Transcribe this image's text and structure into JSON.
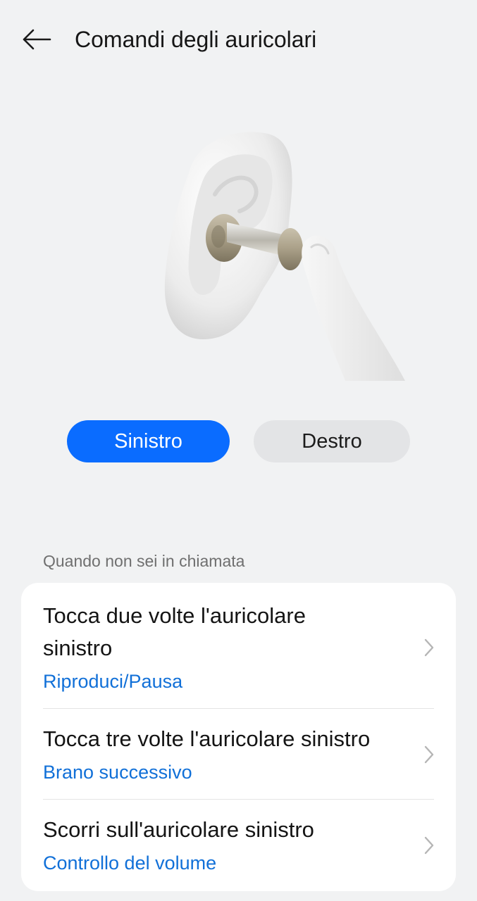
{
  "header": {
    "title": "Comandi degli auricolari"
  },
  "selector": {
    "left_label": "Sinistro",
    "right_label": "Destro",
    "selected": "left"
  },
  "section": {
    "caption": "Quando non sei in chiamata"
  },
  "items": [
    {
      "title": "Tocca due volte l'auricolare sinistro",
      "value": "Riproduci/Pausa"
    },
    {
      "title": "Tocca tre volte l'auricolare sinistro",
      "value": "Brano successivo"
    },
    {
      "title": "Scorri sull'auricolare sinistro",
      "value": "Controllo del volume"
    }
  ],
  "colors": {
    "accent": "#0a6cff",
    "link": "#1170d8",
    "background": "#f1f2f3",
    "card": "#ffffff"
  },
  "icons": {
    "back": "arrow-left-icon",
    "chevron": "chevron-right-icon"
  }
}
